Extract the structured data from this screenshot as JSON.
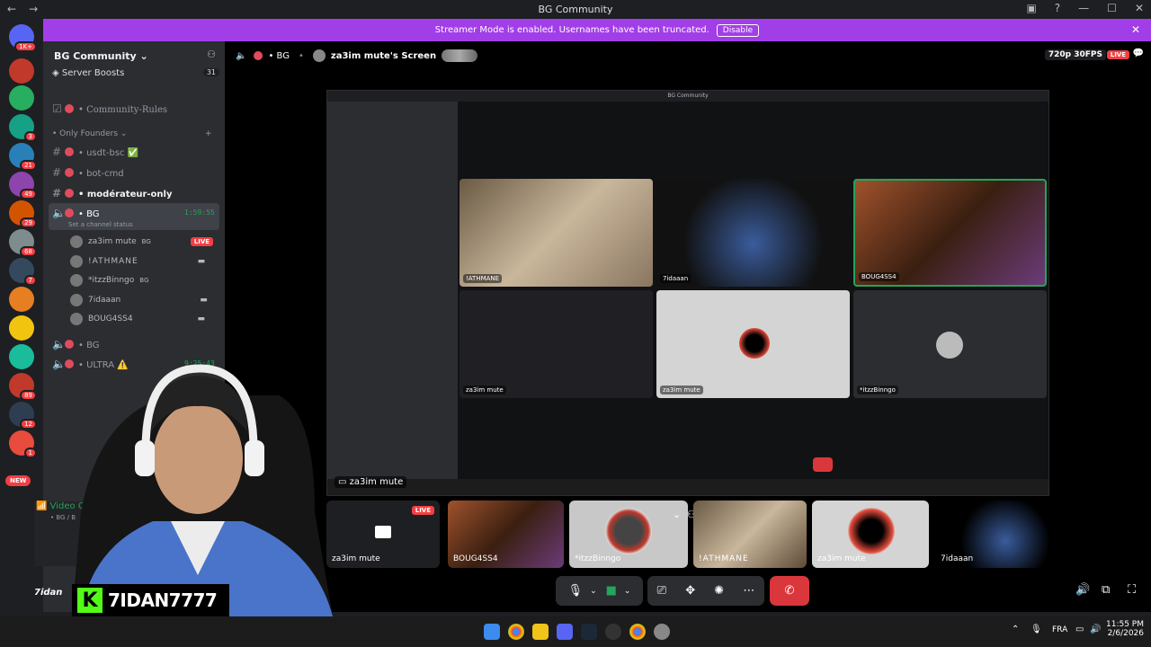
{
  "window": {
    "title": "BG Community"
  },
  "banner": {
    "text": "Streamer Mode is enabled. Usernames have been truncated.",
    "disable_label": "Disable"
  },
  "server": {
    "name": "BG Community"
  },
  "sidebar": {
    "boosts_label": "Server Boosts",
    "boosts_count": "31",
    "rules_channel": "• Community-Rules",
    "category": "• Only Founders",
    "channels": [
      "• usdt-bsc ✅",
      "• bot-cmd",
      "• modérateur-only"
    ],
    "voice_channel": "• BG",
    "voice_timer": "1:59:55",
    "voice_status": "Set a channel status",
    "voice_users": [
      {
        "name": "za3im mute",
        "tag": "BG",
        "live": "LIVE"
      },
      {
        "name": "!ATHMANE"
      },
      {
        "name": "*itzzBinngo",
        "tag": "BG"
      },
      {
        "name": "7idaaan"
      },
      {
        "name": "BOUG4SS4"
      }
    ],
    "voice_channel_2": "• BG",
    "voice_channel_3": "• ULTRA ⚠️",
    "voice_timer_3": "9:25:43",
    "video_panel": "Video C",
    "video_sub": "• BG / B"
  },
  "rail": {
    "badges": [
      "1K+",
      "3",
      "21",
      "49",
      "29",
      "68",
      "7",
      "89",
      "12",
      "1"
    ],
    "new_label": "NEW"
  },
  "call": {
    "channel": "• BG",
    "screen_title": "za3im mute's Screen",
    "quality": "720p 30FPS",
    "live": "LIVE",
    "screen_owner_label": "za3im mute"
  },
  "shared": {
    "title": "BG Community",
    "tiles": [
      "!ATHMANE",
      "7idaaan",
      "BOUG4SS4",
      "za3im mute",
      "za3im mute",
      "*itzzBinngo"
    ]
  },
  "tiles": [
    {
      "name": "za3im mute",
      "live": "LIVE"
    },
    {
      "name": "BOUG4SS4"
    },
    {
      "name": "*itzzBinngo"
    },
    {
      "name": "!ATHMANE"
    },
    {
      "name": "za3im mute"
    },
    {
      "name": "7idaaan"
    }
  ],
  "streamer": {
    "name": "7IDAN7777",
    "logo": "K"
  },
  "taskbar": {
    "lang": "FRA",
    "time": "11:55 PM",
    "date": "2/6/2026"
  },
  "user": {
    "name": "7idan"
  }
}
